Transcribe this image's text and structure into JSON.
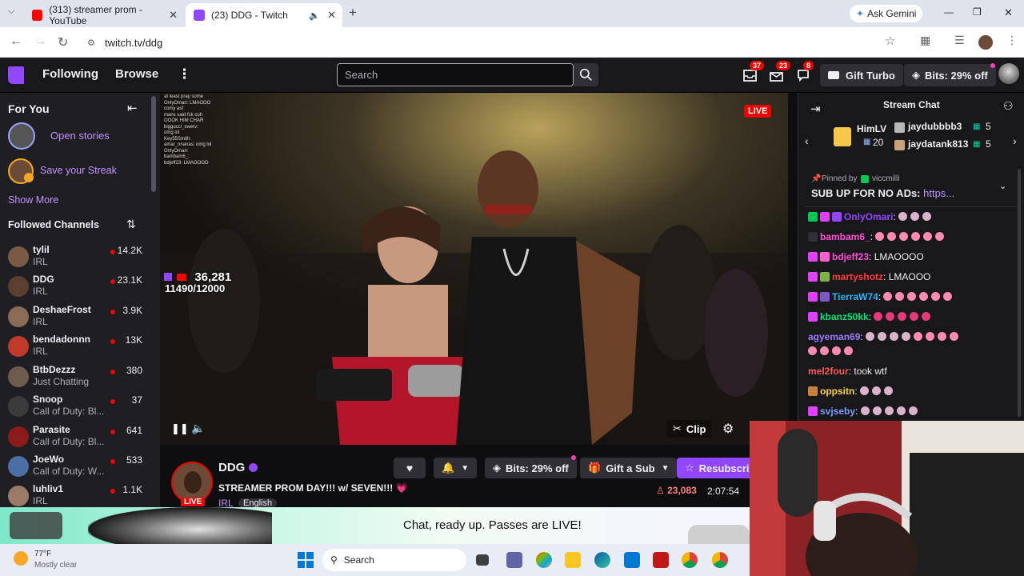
{
  "browser": {
    "tabs": [
      {
        "title": "(313) streamer prom - YouTube"
      },
      {
        "title": "(23) DDG - Twitch"
      }
    ],
    "ask_gemini": "Ask Gemini",
    "url": "twitch.tv/ddg"
  },
  "header": {
    "following": "Following",
    "browse": "Browse",
    "search_placeholder": "Search",
    "notif_counts": [
      "37",
      "23",
      "8"
    ],
    "gift_turbo": "Gift Turbo",
    "bits": "Bits: 29% off"
  },
  "sidebar": {
    "for_you": "For You",
    "open_stories": "Open stories",
    "save_streak": "Save your Streak",
    "show_more": "Show More",
    "followed_title": "Followed Channels",
    "channels": [
      {
        "name": "tylil",
        "category": "IRL",
        "viewers": "14.2K"
      },
      {
        "name": "DDG",
        "category": "IRL",
        "viewers": "23.1K"
      },
      {
        "name": "DeshaeFrost",
        "category": "IRL",
        "viewers": "3.9K"
      },
      {
        "name": "bendadonnn",
        "category": "IRL",
        "viewers": "13K"
      },
      {
        "name": "BtbDezzz",
        "category": "Just Chatting",
        "viewers": "380"
      },
      {
        "name": "Snoop",
        "category": "Call of Duty: Bl...",
        "viewers": "37"
      },
      {
        "name": "Parasite",
        "category": "Call of Duty: Bl...",
        "viewers": "641"
      },
      {
        "name": "JoeWo",
        "category": "Call of Duty: W...",
        "viewers": "533"
      },
      {
        "name": "luhliv1",
        "category": "IRL",
        "viewers": "1.1K"
      }
    ]
  },
  "video": {
    "live": "LIVE",
    "overlay_viewers": "36,281",
    "overlay_goal": "11490/12000",
    "clip": "Clip",
    "overlay_chat": [
      "at least pray some",
      "OnlyOmari: LMAOOO",
      "comy asf",
      "mans said fck cuh",
      "OOOK HIM CHAR",
      "biggucci_swerv:",
      "omg lol",
      "Key55Smith:",
      "amar_nnanas: omg lol",
      "OnlyOmari:",
      "bambam6_:",
      "bdjeff23: LMAOOOO"
    ]
  },
  "channel": {
    "name": "DDG",
    "title": "STREAMER PROM DAY!!! w/ SEVEN!!! 💗",
    "category": "IRL",
    "language": "English",
    "live_tag": "LIVE",
    "bits_button": "Bits: 29% off",
    "gift_sub": "Gift a Sub",
    "resubscribe": "Resubscri",
    "viewers": "23,083",
    "uptime": "2:07:54"
  },
  "promo": {
    "text": "Chat, ready up. Passes are LIVE!"
  },
  "taskbar": {
    "temp": "77°F",
    "weather": "Mostly clear",
    "search": "Search"
  },
  "chat": {
    "title": "Stream Chat",
    "gifters": [
      {
        "name": "HimLV",
        "count": "20"
      },
      {
        "name": "jaydubbbb3",
        "count": "5"
      },
      {
        "name": "jaydatank813",
        "count": "5"
      }
    ],
    "pinned_by": "Pinned by",
    "pinned_user": "viccmilli",
    "pinned_text": "SUB UP FOR NO ADs: ",
    "pinned_link": "https...",
    "messages": [
      {
        "user": "OnlyOmari",
        "color": "#9146ff",
        "text": ""
      },
      {
        "user": "bambam6_",
        "color": "#ff4fd8",
        "text": ""
      },
      {
        "user": "bdjeff23",
        "color": "#ff4fd8",
        "text": "LMAOOOO"
      },
      {
        "user": "martyshotz",
        "color": "#ff3b3b",
        "text": "LMAOOO"
      },
      {
        "user": "TierraW74",
        "color": "#29b6f6",
        "text": ""
      },
      {
        "user": "kbanz50kk",
        "color": "#00e676",
        "text": ""
      },
      {
        "user": "agyeman69",
        "color": "#9d7bff",
        "text": ""
      },
      {
        "user": "mel2four",
        "color": "#ff5b5b",
        "text": "took wtf"
      },
      {
        "user": "oppsitn",
        "color": "#ffd54f",
        "text": ""
      },
      {
        "user": "svjseby",
        "color": "#7c9cff",
        "text": ""
      }
    ]
  }
}
